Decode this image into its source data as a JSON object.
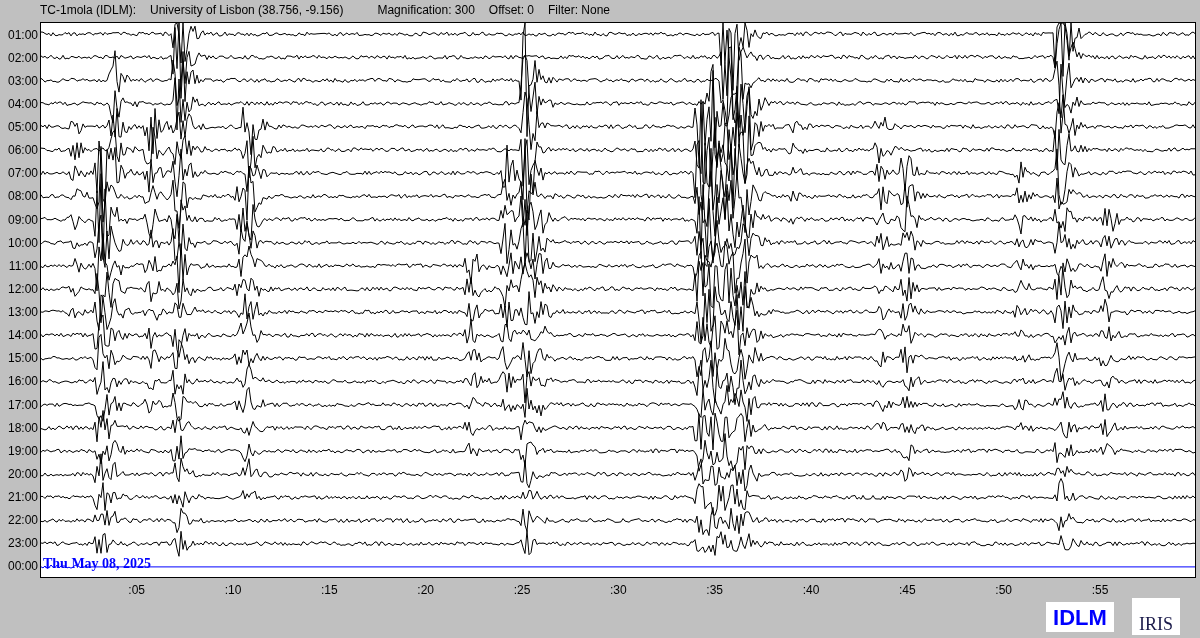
{
  "header": {
    "station": "TC-1mola (IDLM):",
    "location": "University of Lisbon (38.756, -9.156)",
    "magnification": "Magnification: 300",
    "offset": "Offset: 0",
    "filter": "Filter: None"
  },
  "hour_labels": [
    "01:00",
    "02:00",
    "03:00",
    "04:00",
    "05:00",
    "06:00",
    "07:00",
    "08:00",
    "09:00",
    "10:00",
    "11:00",
    "12:00",
    "13:00",
    "14:00",
    "15:00",
    "16:00",
    "17:00",
    "18:00",
    "19:00",
    "20:00",
    "21:00",
    "22:00",
    "23:00",
    "00:00"
  ],
  "date_label": "Thu May 08, 2025",
  "x_axis_labels": [
    ":05",
    ":10",
    ":15",
    ":20",
    ":25",
    ":30",
    ":35",
    ":40",
    ":45",
    ":50",
    ":55"
  ],
  "logos": {
    "station_logo": "IDLM",
    "network_logo": "IRIS"
  }
}
